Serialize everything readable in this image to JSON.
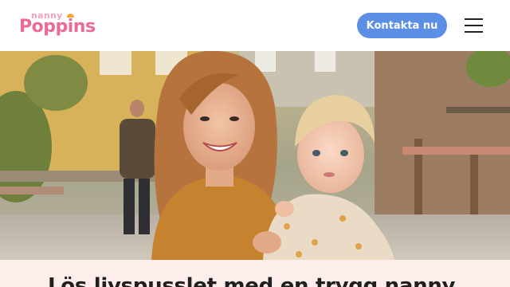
{
  "header": {
    "logo_top": "nanny",
    "logo_main": "Poppins",
    "cta_label": "Kontakta nu"
  },
  "hero": {
    "headline": "Lös livspusslet med en trygg nanny"
  },
  "colors": {
    "brand_pink": "#ec6a97",
    "brand_light_pink": "#f4a2c0",
    "accent_orange": "#f7a533",
    "cta_blue": "#5b8fe6",
    "band_background": "#fdeeec"
  },
  "icons": {
    "menu": "hamburger-menu-icon"
  }
}
